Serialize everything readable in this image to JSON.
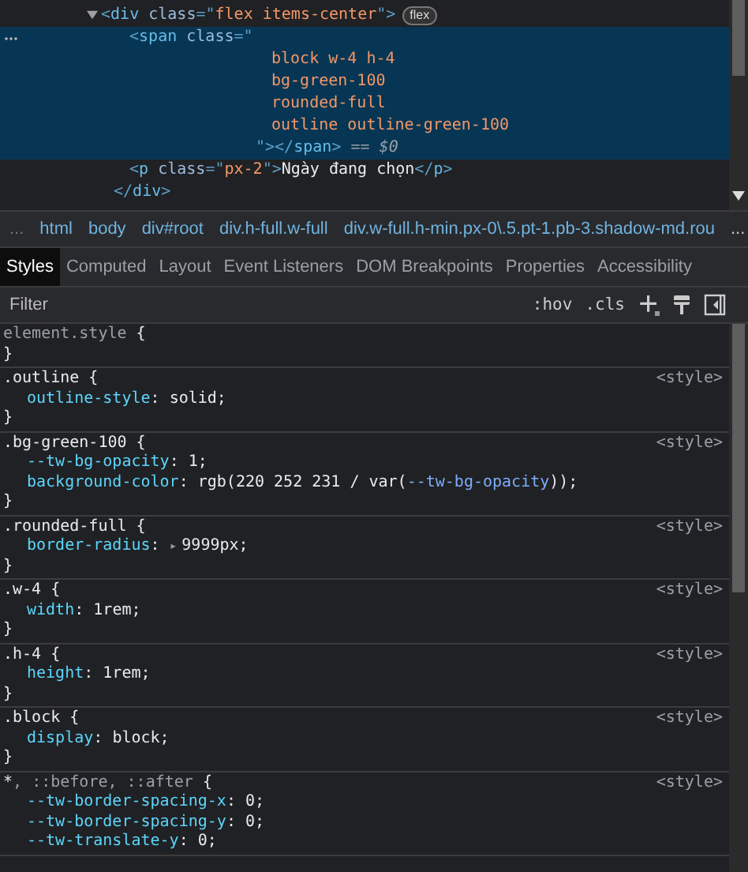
{
  "dom_tree": [
    {
      "expanded": true,
      "parts": [
        {
          "kind": "punct",
          "text": "<"
        },
        {
          "kind": "tag",
          "text": "div"
        },
        {
          "kind": "attr",
          "text": " class"
        },
        {
          "kind": "punct",
          "text": "=\""
        },
        {
          "kind": "value",
          "text": "flex items-center"
        },
        {
          "kind": "punct",
          "text": "\">"
        }
      ],
      "badge": "flex",
      "children": [
        {
          "selected": true,
          "parts": [
            {
              "kind": "punct",
              "text": "<"
            },
            {
              "kind": "tag",
              "text": "span"
            },
            {
              "kind": "attr",
              "text": " class"
            },
            {
              "kind": "punct",
              "text": "=\""
            }
          ],
          "class_lines": [
            "block w-4 h-4",
            "bg-green-100",
            "rounded-full",
            "outline outline-green-100"
          ],
          "end_parts": [
            {
              "kind": "punct",
              "text": "\"></"
            },
            {
              "kind": "tag",
              "text": "span"
            },
            {
              "kind": "punct",
              "text": ">"
            },
            {
              "kind": "ref",
              "text": " == $0"
            }
          ]
        },
        {
          "selected": false,
          "parts": [
            {
              "kind": "punct",
              "text": "<"
            },
            {
              "kind": "tag",
              "text": "p"
            },
            {
              "kind": "attr",
              "text": " class"
            },
            {
              "kind": "punct",
              "text": "=\""
            },
            {
              "kind": "value",
              "text": "px-2"
            },
            {
              "kind": "punct",
              "text": "\">"
            },
            {
              "kind": "text",
              "text": "Ngày đang chọn"
            },
            {
              "kind": "punct",
              "text": "</"
            },
            {
              "kind": "tag",
              "text": "p"
            },
            {
              "kind": "punct",
              "text": ">"
            }
          ]
        }
      ],
      "closing": [
        {
          "kind": "punct",
          "text": "</"
        },
        {
          "kind": "tag",
          "text": "div"
        },
        {
          "kind": "punct",
          "text": ">"
        }
      ]
    }
  ],
  "breadcrumb": {
    "lead": "...",
    "items": [
      "html",
      "body",
      "div#root",
      "div.h-full.w-full",
      "div.w-full.h-min.px-0\\.5.pt-1.pb-3.shadow-md.rou"
    ],
    "trail": "..."
  },
  "tabs": [
    {
      "label": "Styles",
      "selected": true
    },
    {
      "label": "Computed",
      "selected": false
    },
    {
      "label": "Layout",
      "selected": false
    },
    {
      "label": "Event Listeners",
      "selected": false
    },
    {
      "label": "DOM Breakpoints",
      "selected": false
    },
    {
      "label": "Properties",
      "selected": false
    },
    {
      "label": "Accessibility",
      "selected": false
    }
  ],
  "filter": {
    "placeholder": "Filter",
    "hov": ":hov",
    "cls": ".cls"
  },
  "rules": [
    {
      "selector_parts": [
        {
          "kind": "dim",
          "text": "element.style"
        },
        {
          "kind": "plain",
          "text": " {"
        }
      ],
      "close": "}"
    },
    {
      "selector_parts": [
        {
          "kind": "plain",
          "text": ".outline {"
        }
      ],
      "source": "<style>",
      "declarations": [
        [
          {
            "kind": "prop",
            "text": "outline-style"
          },
          {
            "kind": "plain",
            "text": ": solid;"
          }
        ]
      ],
      "close": "}"
    },
    {
      "selector_parts": [
        {
          "kind": "plain",
          "text": ".bg-green-100 {"
        }
      ],
      "source": "<style>",
      "declarations": [
        [
          {
            "kind": "prop",
            "text": "--tw-bg-opacity"
          },
          {
            "kind": "plain",
            "text": ": 1;"
          }
        ],
        [
          {
            "kind": "prop",
            "text": "background-color"
          },
          {
            "kind": "plain",
            "text": ": rgb(220 252 231 / var("
          },
          {
            "kind": "var",
            "text": "--tw-bg-opacity"
          },
          {
            "kind": "plain",
            "text": "));"
          }
        ]
      ],
      "close": "}"
    },
    {
      "selector_parts": [
        {
          "kind": "plain",
          "text": ".rounded-full {"
        }
      ],
      "source": "<style>",
      "declarations": [
        [
          {
            "kind": "prop",
            "text": "border-radius"
          },
          {
            "kind": "plain",
            "text": ": "
          },
          {
            "kind": "expander",
            "text": "▸"
          },
          {
            "kind": "plain",
            "text": "9999px;"
          }
        ]
      ],
      "close": "}"
    },
    {
      "selector_parts": [
        {
          "kind": "plain",
          "text": ".w-4 {"
        }
      ],
      "source": "<style>",
      "declarations": [
        [
          {
            "kind": "prop",
            "text": "width"
          },
          {
            "kind": "plain",
            "text": ": 1rem;"
          }
        ]
      ],
      "close": "}"
    },
    {
      "selector_parts": [
        {
          "kind": "plain",
          "text": ".h-4 {"
        }
      ],
      "source": "<style>",
      "declarations": [
        [
          {
            "kind": "prop",
            "text": "height"
          },
          {
            "kind": "plain",
            "text": ": 1rem;"
          }
        ]
      ],
      "close": "}"
    },
    {
      "selector_parts": [
        {
          "kind": "plain",
          "text": ".block {"
        }
      ],
      "source": "<style>",
      "declarations": [
        [
          {
            "kind": "prop",
            "text": "display"
          },
          {
            "kind": "plain",
            "text": ": block;"
          }
        ]
      ],
      "close": "}"
    },
    {
      "selector_parts": [
        {
          "kind": "plain",
          "text": "*"
        },
        {
          "kind": "dim",
          "text": ", ::before, ::after"
        },
        {
          "kind": "plain",
          "text": " {"
        }
      ],
      "source": "<style>",
      "declarations": [
        [
          {
            "kind": "prop",
            "text": "--tw-border-spacing-x"
          },
          {
            "kind": "plain",
            "text": ": 0;"
          }
        ],
        [
          {
            "kind": "prop",
            "text": "--tw-border-spacing-y"
          },
          {
            "kind": "plain",
            "text": ": 0;"
          }
        ],
        [
          {
            "kind": "prop",
            "text": "--tw-translate-y"
          },
          {
            "kind": "plain",
            "text": ": 0;"
          }
        ]
      ]
    }
  ]
}
